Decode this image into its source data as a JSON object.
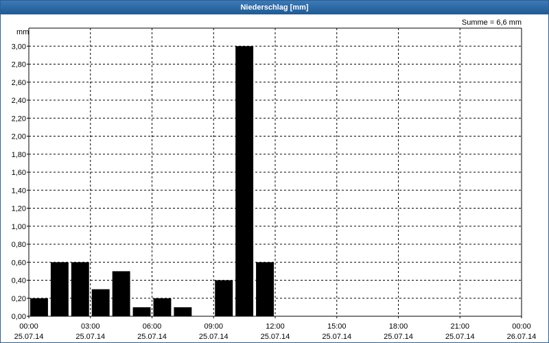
{
  "window": {
    "title": "Niederschlag [mm]"
  },
  "chart_data": {
    "type": "bar",
    "y_unit": "mm",
    "summary": "Summe = 6,6 mm",
    "ylim": [
      0,
      3.0
    ],
    "y_ticks": [
      "0,00",
      "0,20",
      "0,40",
      "0,60",
      "0,80",
      "1,00",
      "1,20",
      "1,40",
      "1,60",
      "1,80",
      "2,00",
      "2,20",
      "2,40",
      "2,60",
      "2,80",
      "3,00"
    ],
    "x_ticks": [
      {
        "time": "00:00",
        "date": "25.07.14"
      },
      {
        "time": "03:00",
        "date": "25.07.14"
      },
      {
        "time": "06:00",
        "date": "25.07.14"
      },
      {
        "time": "09:00",
        "date": "25.07.14"
      },
      {
        "time": "12:00",
        "date": "25.07.14"
      },
      {
        "time": "15:00",
        "date": "25.07.14"
      },
      {
        "time": "18:00",
        "date": "25.07.14"
      },
      {
        "time": "21:00",
        "date": "25.07.14"
      },
      {
        "time": "00:00",
        "date": "26.07.14"
      }
    ],
    "x_range_hours": [
      0,
      24
    ],
    "bar_width_hours": 1,
    "bars": [
      {
        "start_hour": 0,
        "value": 0.2
      },
      {
        "start_hour": 1,
        "value": 0.6
      },
      {
        "start_hour": 2,
        "value": 0.6
      },
      {
        "start_hour": 3,
        "value": 0.3
      },
      {
        "start_hour": 4,
        "value": 0.5
      },
      {
        "start_hour": 5,
        "value": 0.1
      },
      {
        "start_hour": 6,
        "value": 0.2
      },
      {
        "start_hour": 7,
        "value": 0.1
      },
      {
        "start_hour": 8,
        "value": 0.0
      },
      {
        "start_hour": 9,
        "value": 0.4
      },
      {
        "start_hour": 10,
        "value": 3.0
      },
      {
        "start_hour": 11,
        "value": 0.6
      }
    ],
    "grid": true,
    "bar_color": "#000000"
  }
}
